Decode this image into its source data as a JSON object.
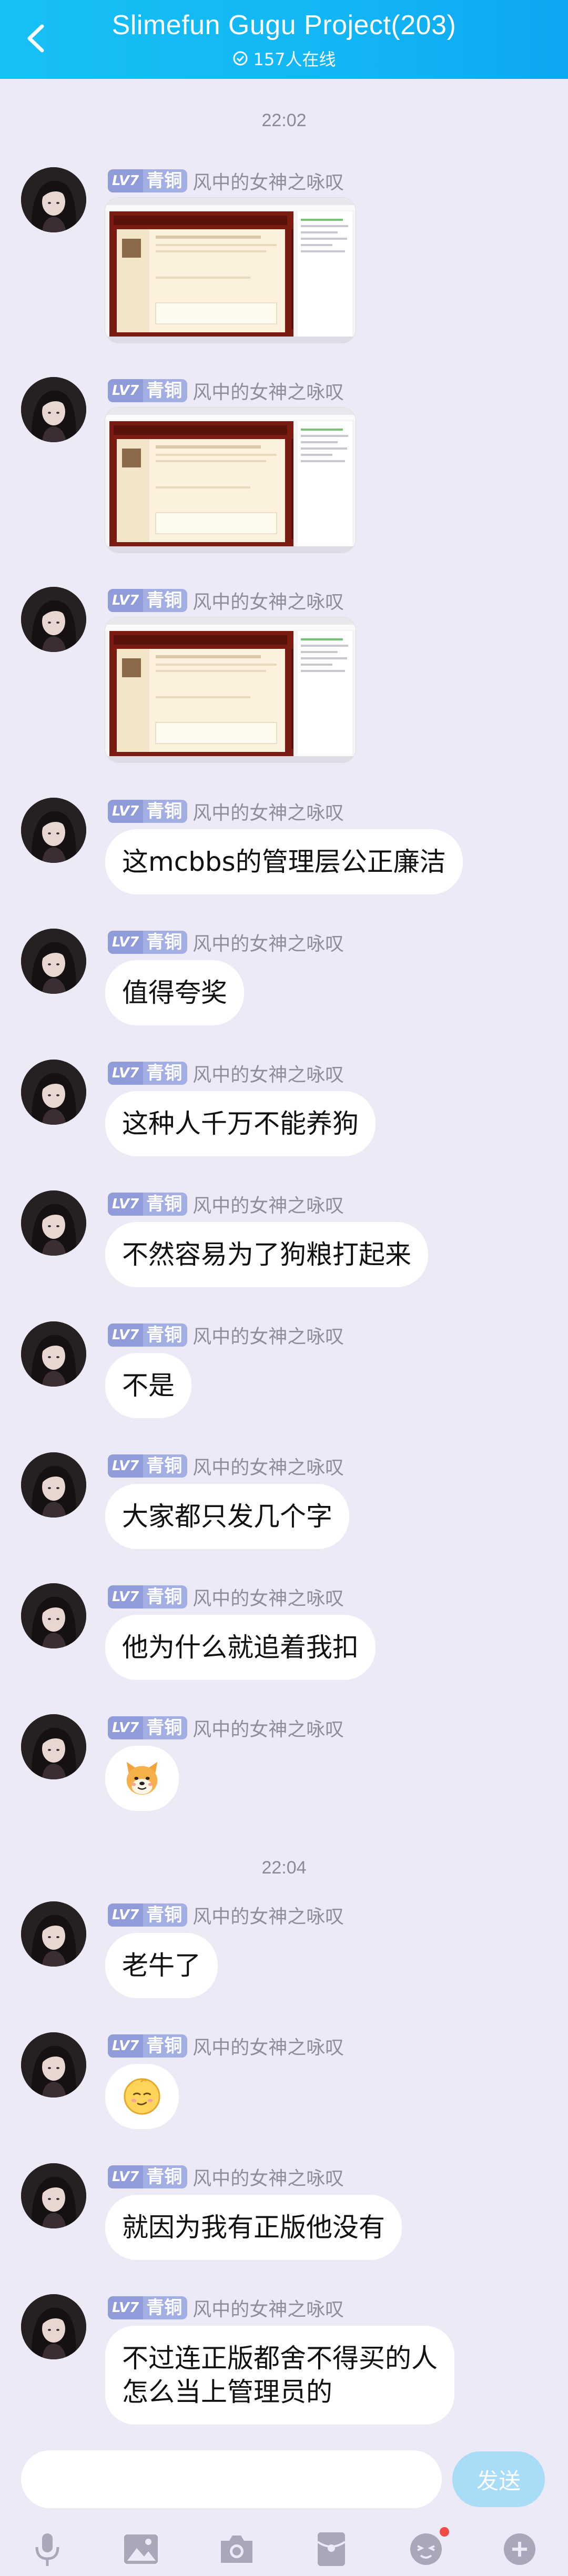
{
  "header": {
    "title": "Slimefun Gugu Project(203)",
    "online": "157人在线"
  },
  "timestamps": [
    "22:02",
    "22:04"
  ],
  "sender": {
    "level": "LV7",
    "rank": "青铜",
    "nickname": "风中的女神之咏叹"
  },
  "messages": [
    {
      "type": "image",
      "alt": "screenshot"
    },
    {
      "type": "image",
      "alt": "screenshot"
    },
    {
      "type": "image",
      "alt": "screenshot"
    },
    {
      "type": "text",
      "text": "这mcbbs的管理层公正廉洁"
    },
    {
      "type": "text",
      "text": "值得夸奖"
    },
    {
      "type": "text",
      "text": "这种人千万不能养狗"
    },
    {
      "type": "text",
      "text": "不然容易为了狗粮打起来"
    },
    {
      "type": "text",
      "text": "不是"
    },
    {
      "type": "text",
      "text": "大家都只发几个字"
    },
    {
      "type": "text",
      "text": "他为什么就追着我扣"
    },
    {
      "type": "emoji",
      "icon": "doge-emoji"
    },
    {
      "type": "text",
      "text": "老牛了"
    },
    {
      "type": "emoji",
      "icon": "smug-face-emoji"
    },
    {
      "type": "text",
      "text": "就因为我有正版他没有"
    },
    {
      "type": "text",
      "lines": [
        "不过连正版都舍不得买的人",
        "怎么当上管理员的"
      ]
    }
  ],
  "input": {
    "placeholder": "",
    "send_label": "发送"
  },
  "toolbar": [
    "microphone-icon",
    "picture-icon",
    "camera-icon",
    "red-packet-icon",
    "emoji-icon",
    "plus-icon"
  ],
  "colors": {
    "header": "#12b6f4",
    "background": "#eceaf6",
    "badge": "#a3afe3",
    "send": "#a9dcf6"
  }
}
